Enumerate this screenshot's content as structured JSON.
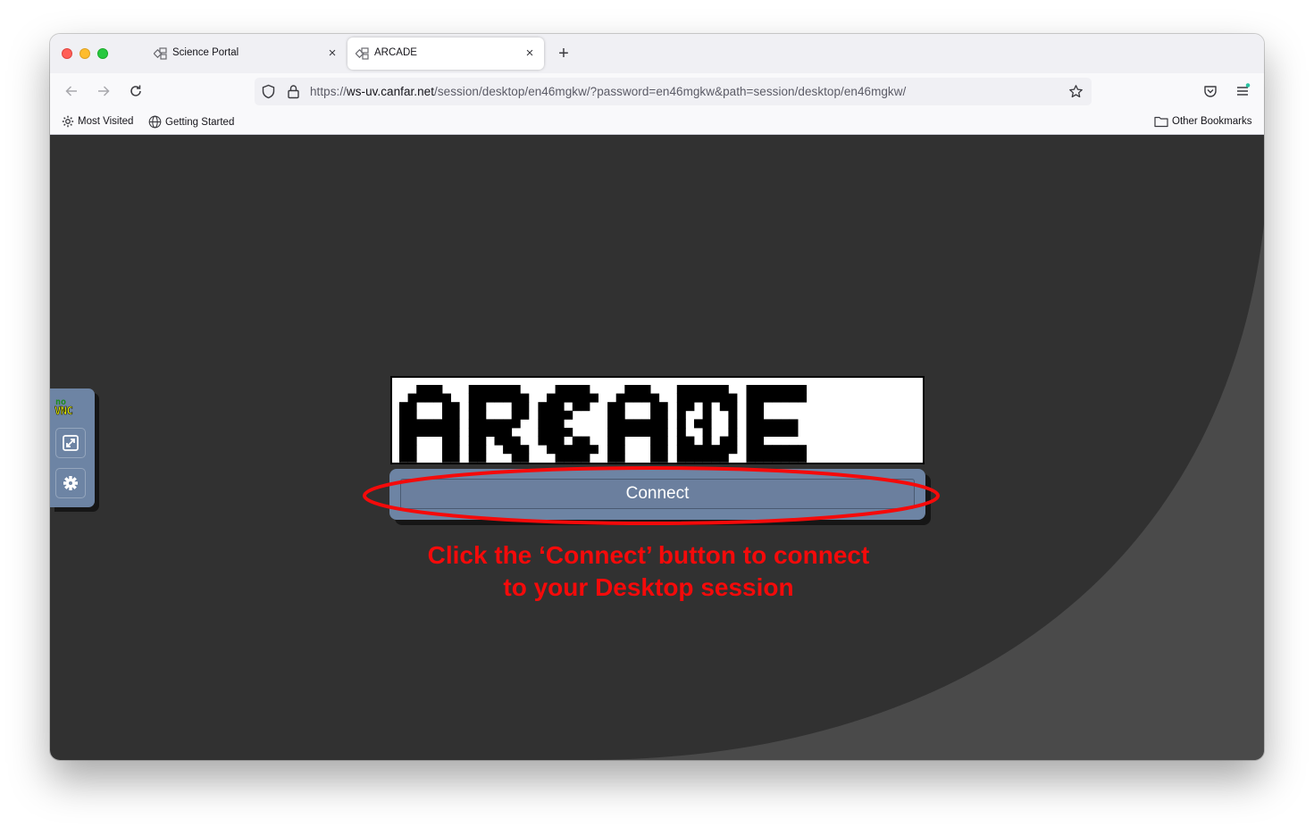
{
  "browser": {
    "tabs": [
      {
        "label": "Science Portal",
        "active": false
      },
      {
        "label": "ARCADE",
        "active": true
      }
    ],
    "url": {
      "scheme": "https://",
      "host": "ws-uv.canfar.net",
      "path": "/session/desktop/en46mgkw/?password=en46mgkw&path=session/desktop/en46mgkw/"
    },
    "bookmarks": {
      "most_visited": "Most Visited",
      "getting_started": "Getting Started",
      "other": "Other Bookmarks"
    }
  },
  "novnc": {
    "logo_top": "no",
    "logo_bottom": "VNC",
    "buttons": [
      "fullscreen-icon",
      "settings-icon"
    ]
  },
  "app": {
    "logo_text": "ARCADE",
    "connect_label": "Connect"
  },
  "annotation": {
    "line1": "Click the ‘Connect’ button to connect",
    "line2": "to your Desktop session",
    "color": "#f50a0a"
  },
  "colors": {
    "panel": "#6d84a4",
    "background": "#313131",
    "curve": "#4a4a4a"
  }
}
